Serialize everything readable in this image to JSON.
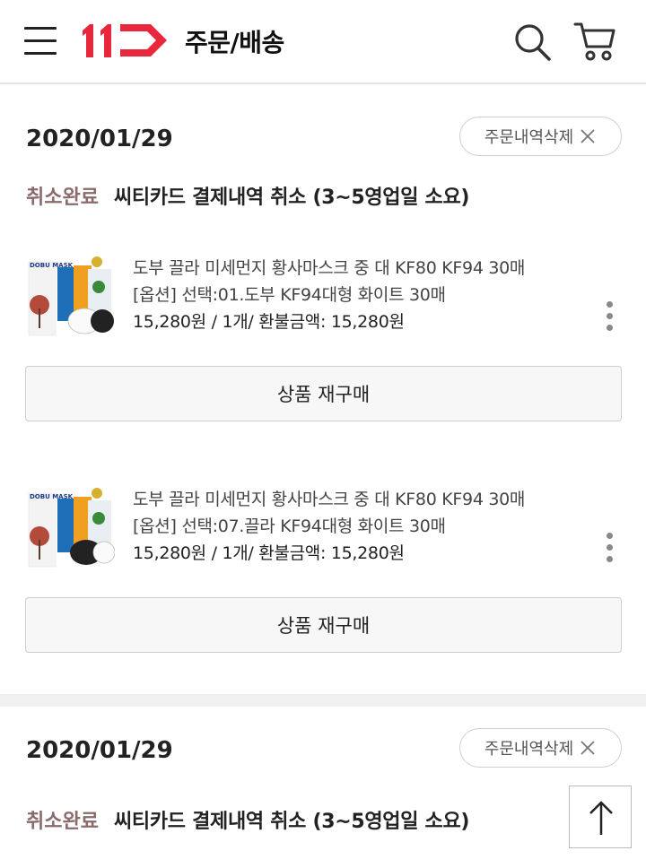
{
  "header": {
    "title": "주문/배송",
    "logo_text": "11",
    "menu_icon": "hamburger-menu-icon",
    "search_icon": "search-icon",
    "cart_icon": "cart-icon",
    "brand_color": "#e8263c"
  },
  "orders": [
    {
      "date": "2020/01/29",
      "delete_label": "주문내역삭제",
      "status": "취소완료",
      "status_desc": "씨티카드 결제내역 취소 (3~5영업일 소요)",
      "items": [
        {
          "name": "도부 끌라 미세먼지 황사마스크 중 대 KF80 KF94 30매",
          "option": "[옵션] 선택:01.도부 KF94대형 화이트 30매",
          "price": "15,280원 / 1개/ 환불금액: 15,280원",
          "rebuy_label": "상품 재구매",
          "thumb_text": "DOBU MASK"
        },
        {
          "name": "도부 끌라 미세먼지 황사마스크 중 대 KF80 KF94 30매",
          "option": "[옵션] 선택:07.끌라 KF94대형 화이트 30매",
          "price": "15,280원 / 1개/ 환불금액: 15,280원",
          "rebuy_label": "상품 재구매",
          "thumb_text": "DOBU MASK"
        }
      ]
    },
    {
      "date": "2020/01/29",
      "delete_label": "주문내역삭제",
      "status": "취소완료",
      "status_desc": "씨티카드 결제내역 취소 (3~5영업일 소요)"
    }
  ],
  "scroll_top_icon": "arrow-up-icon"
}
